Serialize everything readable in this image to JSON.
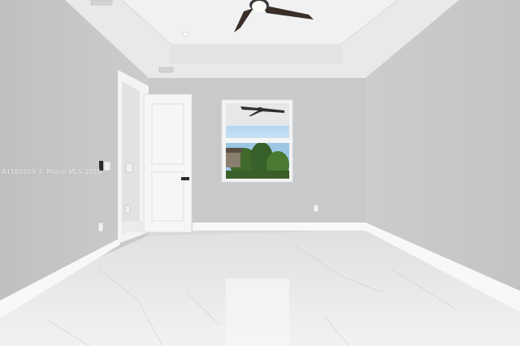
{
  "photo": {
    "watermark_text": "A1185029 © Miami MLS 2025",
    "colors": {
      "left_wall": "#c7c8c9",
      "back_wall": "#c9cacb",
      "right_wall": "#c5c6c7",
      "ceiling": "#e9eaeb",
      "floor": "#eeeff0",
      "baseboard": "#fbfbfb",
      "door": "#f5f5f5",
      "sky": "#9ec9ea",
      "foliage": "#3f6a2a"
    }
  }
}
